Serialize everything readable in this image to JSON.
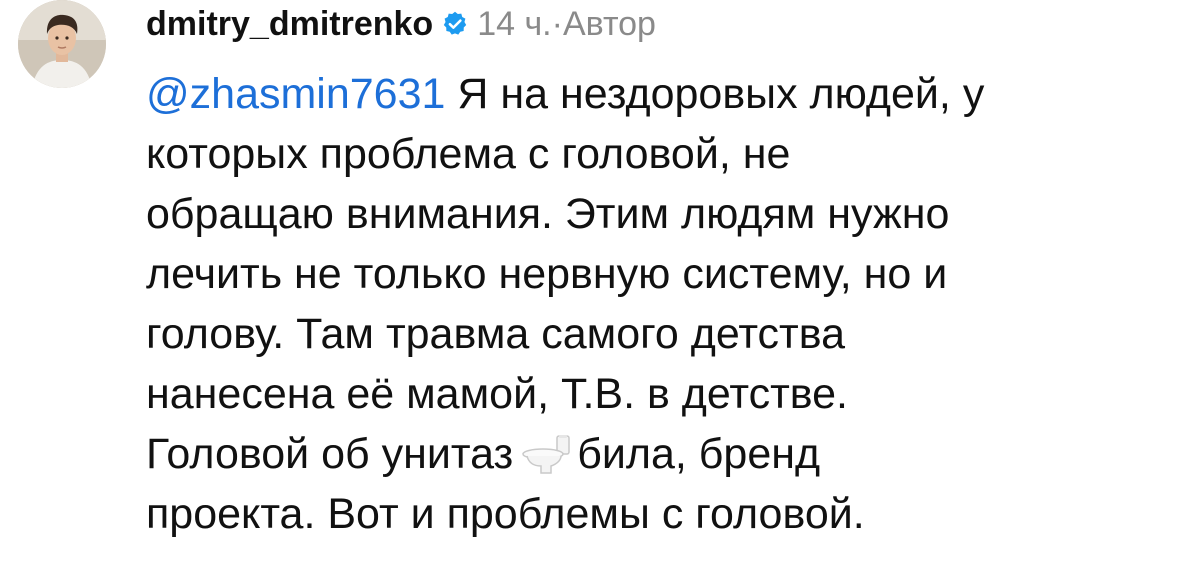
{
  "comment": {
    "author": {
      "username": "dmitry_dmitrenko",
      "verified": true,
      "avatar": "avatar-photo"
    },
    "time": "14 ч.",
    "separator": "·",
    "author_badge": "Автор",
    "mention": "@zhasmin7631",
    "lines": [
      " Я на нездоровых людей, у",
      "которых проблема с головой, не",
      "обращаю внимания. Этим людям нужно",
      "лечить не только нервную систему, но и",
      "голову. Там травма самого детства",
      "нанесена её мамой, Т.В. в детстве.",
      "Головой об унитаз",
      "била, бренд",
      "проекта. Вот и проблемы с головой."
    ],
    "emoji": "toilet-icon"
  },
  "colors": {
    "mention": "#1d6fd8",
    "verified_badge": "#1d9bf0",
    "meta_text": "#8a8a8a"
  }
}
